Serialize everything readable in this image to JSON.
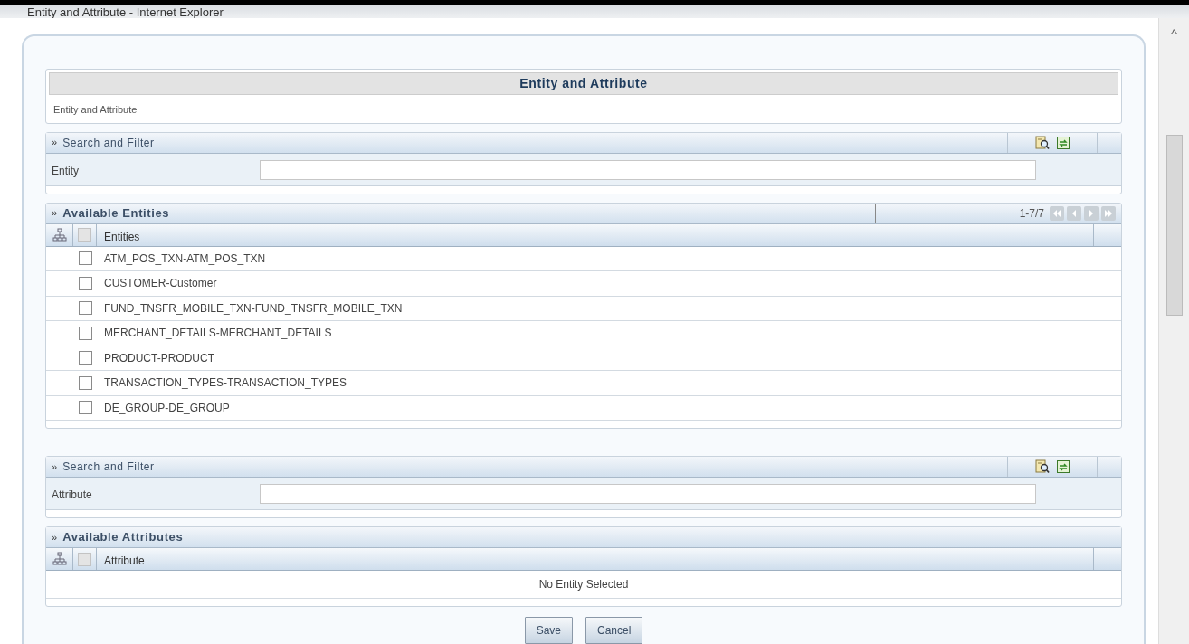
{
  "window": {
    "title": "Entity and Attribute - Internet Explorer"
  },
  "page": {
    "title": "Entity and Attribute",
    "subtitle": "Entity and Attribute"
  },
  "entity_filter": {
    "glyph": "»",
    "header": "Search and Filter",
    "label": "Entity"
  },
  "entities": {
    "glyph": "»",
    "header": "Available Entities",
    "pager": "1-7/7",
    "pager_buttons": [
      {
        "kind": "first",
        "disabled": true
      },
      {
        "kind": "prev",
        "disabled": true
      },
      {
        "kind": "next",
        "disabled": true
      },
      {
        "kind": "last",
        "disabled": true
      }
    ],
    "select_all_checked": false,
    "column": "Entities",
    "rows": [
      {
        "label": "ATM_POS_TXN-ATM_POS_TXN",
        "checked": false
      },
      {
        "label": "CUSTOMER-Customer",
        "checked": false
      },
      {
        "label": "FUND_TNSFR_MOBILE_TXN-FUND_TNSFR_MOBILE_TXN",
        "checked": false
      },
      {
        "label": "MERCHANT_DETAILS-MERCHANT_DETAILS",
        "checked": false
      },
      {
        "label": "PRODUCT-PRODUCT",
        "checked": false
      },
      {
        "label": "TRANSACTION_TYPES-TRANSACTION_TYPES",
        "checked": false
      },
      {
        "label": "DE_GROUP-DE_GROUP",
        "checked": false
      }
    ]
  },
  "attribute_filter": {
    "glyph": "»",
    "header": "Search and Filter",
    "label": "Attribute"
  },
  "attributes": {
    "glyph": "»",
    "header": "Available Attributes",
    "select_all_checked": false,
    "column": "Attribute",
    "empty_message": "No Entity Selected"
  },
  "scroll_up": "^",
  "buttons": [
    "Save",
    "Cancel"
  ]
}
